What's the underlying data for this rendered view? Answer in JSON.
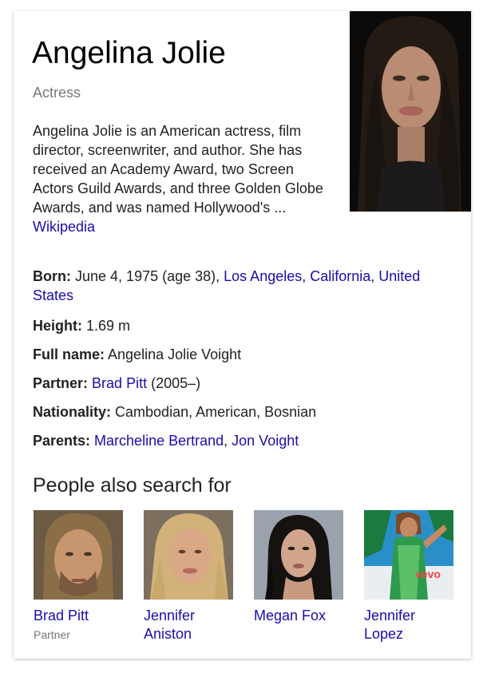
{
  "entity": {
    "name": "Angelina Jolie",
    "type": "Actress",
    "description": "Angelina Jolie is an American actress, film director, screenwriter, and author. She has received an Academy Award, two Screen Actors Guild Awards, and three Golden Globe Awards, and was named Hollywood's ... ",
    "source_link": "Wikipedia"
  },
  "facts": {
    "born": {
      "label": "Born:",
      "text": "June 4, 1975 (age 38), ",
      "link": "Los Angeles, California, United States"
    },
    "height": {
      "label": "Height:",
      "text": "1.69 m"
    },
    "full_name": {
      "label": "Full name:",
      "text": "Angelina Jolie Voight"
    },
    "partner": {
      "label": "Partner:",
      "link": "Brad Pitt",
      "text": " (2005–)"
    },
    "nationality": {
      "label": "Nationality:",
      "text": "Cambodian, American, Bosnian"
    },
    "parents": {
      "label": "Parents:",
      "link1": "Marcheline Bertrand",
      "sep": ", ",
      "link2": "Jon Voight"
    }
  },
  "people_also_search": {
    "title": "People also search for",
    "items": [
      {
        "name": "Brad Pitt",
        "sub": "Partner"
      },
      {
        "name": "Jennifer Aniston",
        "sub": ""
      },
      {
        "name": "Megan Fox",
        "sub": ""
      },
      {
        "name": "Jennifer Lopez",
        "sub": ""
      }
    ],
    "thumb_badge": "vevo"
  },
  "colors": {
    "link": "#1a0dab",
    "muted": "#777777",
    "text": "#222222"
  }
}
